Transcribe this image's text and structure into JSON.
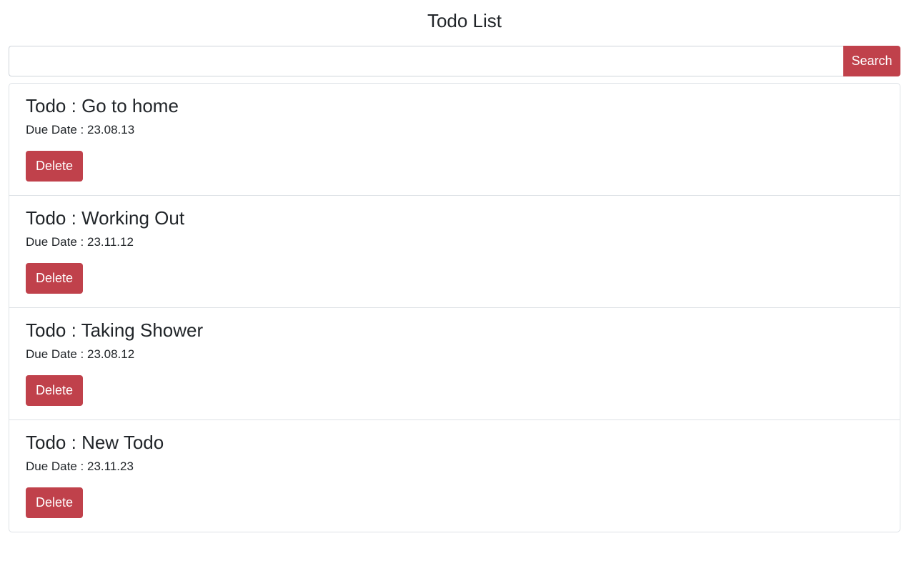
{
  "header": {
    "title": "Todo List"
  },
  "search": {
    "value": "",
    "placeholder": "",
    "button_label": "Search"
  },
  "todos": [
    {
      "title_prefix": "Todo : ",
      "title": "Go to home",
      "due_prefix": "Due Date : ",
      "due": "23.08.13",
      "delete_label": "Delete"
    },
    {
      "title_prefix": "Todo : ",
      "title": "Working Out",
      "due_prefix": "Due Date : ",
      "due": "23.11.12",
      "delete_label": "Delete"
    },
    {
      "title_prefix": "Todo : ",
      "title": "Taking Shower",
      "due_prefix": "Due Date : ",
      "due": "23.08.12",
      "delete_label": "Delete"
    },
    {
      "title_prefix": "Todo : ",
      "title": "New Todo",
      "due_prefix": "Due Date : ",
      "due": "23.11.23",
      "delete_label": "Delete"
    }
  ],
  "colors": {
    "accent": "#c0414b",
    "text": "#212529",
    "border": "#dee2e6"
  }
}
